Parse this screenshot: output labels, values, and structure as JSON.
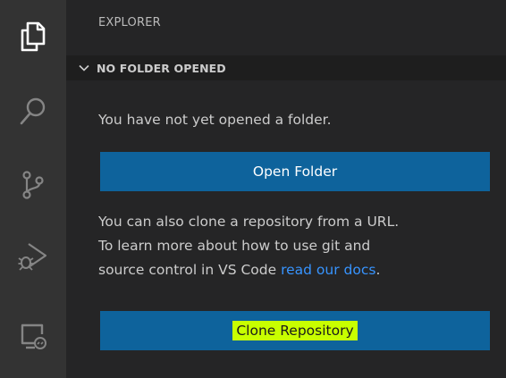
{
  "activity_bar": {
    "icons": [
      "files-icon",
      "search-icon",
      "source-control-icon",
      "run-debug-icon",
      "remote-explorer-icon"
    ]
  },
  "sidebar": {
    "title": "EXPLORER",
    "section": {
      "title": "NO FOLDER OPENED",
      "expanded": true
    },
    "message": "You have not yet opened a folder.",
    "open_folder_label": "Open Folder",
    "clone_message_line1": "You can also clone a repository from a URL.",
    "clone_message_line2": "To learn more about how to use git and",
    "clone_message_line3": "source control in VS Code ",
    "docs_link": "read our docs",
    "clone_message_end": ".",
    "clone_label": "Clone Repository"
  },
  "colors": {
    "activity_bar_bg": "#333333",
    "sidebar_bg": "#252526",
    "button_bg": "#0e639c",
    "link": "#3794ff",
    "highlight": "#c8ff00"
  }
}
